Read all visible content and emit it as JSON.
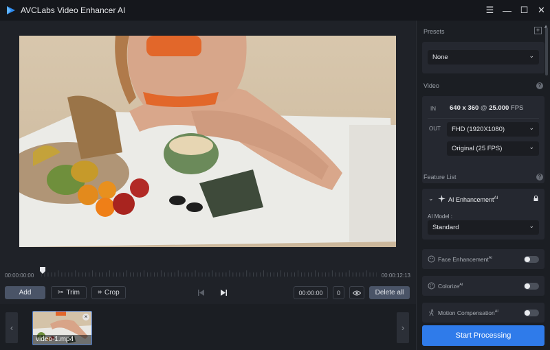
{
  "app": {
    "title": "AVCLabs Video Enhancer AI"
  },
  "window_controls": {
    "menu": "☰",
    "minimize": "—",
    "maximize": "☐",
    "close": "✕"
  },
  "timeline": {
    "start": "00:00:00:00",
    "end": "00:00:12:13"
  },
  "toolbar": {
    "add_label": "Add",
    "trim_label": "Trim",
    "crop_label": "Crop",
    "time_value": "00:00:00",
    "frame_value": "0",
    "delete_all_label": "Delete all"
  },
  "thumbnails": [
    {
      "label": "video-1.mp4"
    }
  ],
  "presets": {
    "label": "Presets",
    "add": "+",
    "selected": "None"
  },
  "video": {
    "label": "Video",
    "in_label": "IN",
    "out_label": "OUT",
    "in_resolution": "640 x 360",
    "in_at": "@",
    "in_fps_value": "25.000",
    "in_fps_unit": "FPS",
    "out_resolution": "FHD (1920X1080)",
    "out_fps": "Original (25 FPS)"
  },
  "feature_list": {
    "label": "Feature List",
    "ai_enhancement": {
      "title": "AI Enhancement",
      "badge": "AI",
      "model_label": "AI Model :",
      "model_selected": "Standard"
    },
    "items": [
      {
        "label": "Face Enhancement",
        "badge": "AI",
        "enabled": false
      },
      {
        "label": "Colorize",
        "badge": "AI",
        "enabled": false
      },
      {
        "label": "Motion Compensation",
        "badge": "AI",
        "enabled": false
      }
    ]
  },
  "start_button": "Start Processing",
  "colors": {
    "accent": "#2f7bea",
    "panel": "#252830",
    "background": "#1f2228"
  },
  "icons": [
    "app-logo-icon",
    "scissors-icon",
    "crop-icon",
    "skip-back-icon",
    "play-icon",
    "eye-icon",
    "chevron-left-icon",
    "chevron-right-icon",
    "chevron-down-icon",
    "help-icon",
    "lock-icon",
    "face-icon",
    "palette-icon",
    "motion-icon",
    "sparkle-icon"
  ]
}
